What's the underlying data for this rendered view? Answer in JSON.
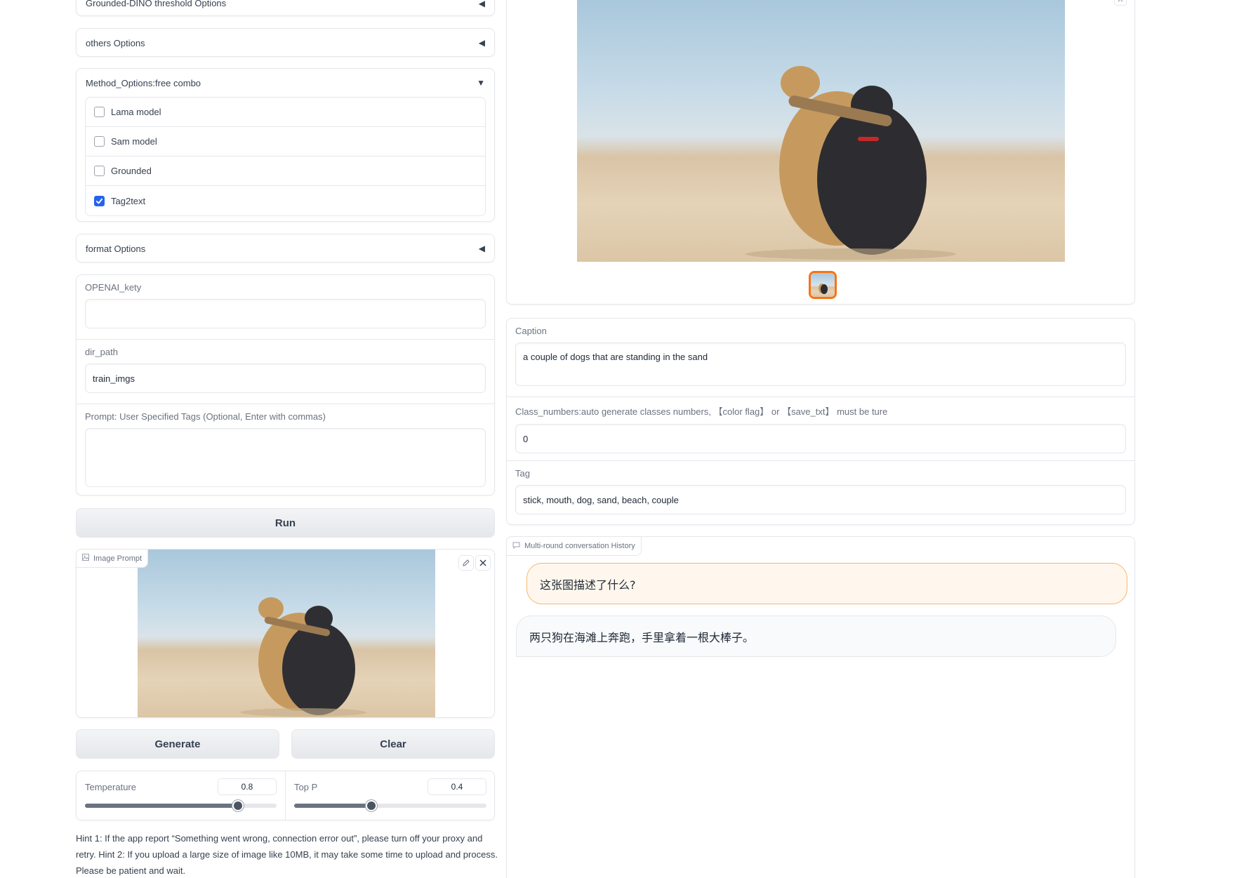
{
  "left": {
    "grounded_header": "Grounded-DINO threshold Options",
    "others_header": "others Options",
    "method": {
      "header": "Method_Options:free combo",
      "options": [
        {
          "label": "Lama model",
          "checked": false
        },
        {
          "label": "Sam model",
          "checked": false
        },
        {
          "label": "Grounded",
          "checked": false
        },
        {
          "label": "Tag2text",
          "checked": true
        }
      ]
    },
    "format_header": "format Options",
    "openai_label": "OPENAI_kety",
    "openai_value": "",
    "dir_label": "dir_path",
    "dir_value": "train_imgs",
    "prompt_label": "Prompt: User Specified Tags (Optional, Enter with commas)",
    "prompt_value": "",
    "run_label": "Run",
    "image_prompt_label": "Image Prompt",
    "generate_label": "Generate",
    "clear_label": "Clear",
    "temperature": {
      "label": "Temperature",
      "value": "0.8",
      "fraction": 0.8
    },
    "top_p": {
      "label": "Top P",
      "value": "0.4",
      "fraction": 0.4
    },
    "hint": "Hint 1: If the app report “Something went wrong, connection error out”, please turn off your proxy and retry. Hint 2: If you upload a large size of image like 10MB, it may take some time to upload and process. Please be patient and wait."
  },
  "right": {
    "caption_label": "Caption",
    "caption_value": "a couple of dogs that are standing in the sand",
    "class_label": "Class_numbers:auto generate classes numbers, 【color flag】 or 【save_txt】 must be ture",
    "class_value": "0",
    "tag_label": "Tag",
    "tag_value": "stick, mouth, dog, sand, beach, couple",
    "history_label": "Multi-round conversation History",
    "messages": [
      {
        "role": "user",
        "text": "这张图描述了什么?"
      },
      {
        "role": "bot",
        "text": "两只狗在海滩上奔跑，手里拿着一根大棒子。"
      }
    ]
  },
  "colors": {
    "accent": "#f97316",
    "checkbox": "#2563eb",
    "user_bubble": "#fff7ed",
    "bot_bubble": "#f9fafb"
  }
}
